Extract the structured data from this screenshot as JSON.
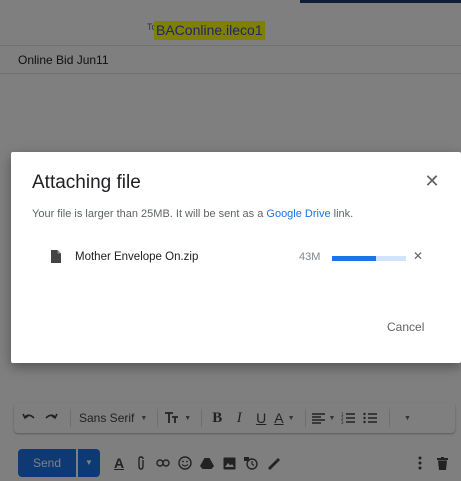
{
  "compose": {
    "to_label": "To",
    "to_recipient": "BAConline.ileco1",
    "subject": "Online Bid Jun11"
  },
  "format_toolbar": {
    "undo_icon": "undo-icon",
    "redo_icon": "redo-icon",
    "font_name": "Sans Serif",
    "text_size_icon": "text-size-icon",
    "bold_label": "B",
    "italic_label": "I",
    "underline_label": "U",
    "text_color_label": "A",
    "align_icon": "align-icon",
    "numbered_list_icon": "numbered-list-icon",
    "bulleted_list_icon": "bulleted-list-icon",
    "more_icon": "more-formatting-icon"
  },
  "send_bar": {
    "send_label": "Send",
    "tools": [
      "formatting-icon",
      "attach-icon",
      "link-icon",
      "emoji-icon",
      "drive-icon",
      "photo-icon",
      "confidential-icon",
      "signature-icon"
    ],
    "more_icon": "more-options-icon",
    "discard_icon": "trash-icon",
    "formatting_label": "A"
  },
  "dialog": {
    "title": "Attaching file",
    "message_prefix": "Your file is larger than 25MB. It will be sent as a ",
    "message_link": "Google Drive",
    "message_suffix": " link.",
    "file": {
      "name": "Mother Envelope On.zip",
      "size": "43M",
      "progress_percent": 60
    },
    "cancel_label": "Cancel"
  },
  "colors": {
    "accent": "#1a73e8",
    "highlight": "#ffff00"
  }
}
